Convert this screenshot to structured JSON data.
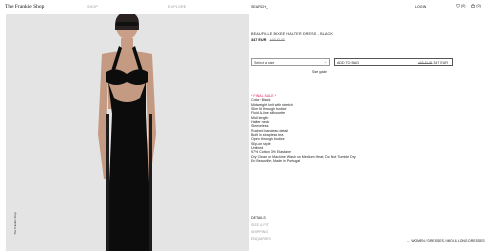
{
  "header": {
    "brand": "The Frankie Shop",
    "nav_shop": "SHOP",
    "nav_explore": "EXPLORE",
    "search": "SEARCH_",
    "login": "LOGIN",
    "wishlist_count": "(0)",
    "bag_count": "(0)"
  },
  "product": {
    "title": "BEAUFILLE BIXEE HALTER DRESS - BLACK",
    "price_now": "347 EUR",
    "price_was": "495 EUR",
    "size_placeholder": "Select a size",
    "add_to_bag": "ADD TO BAG",
    "add_to_bag_price_was": "495 EUR",
    "add_to_bag_price_now": "347 EUR",
    "size_guide": "Size guide",
    "final_sale": "* FINAL SALE *",
    "details": [
      "Color: Black",
      "Midweight knit with stretch",
      "Slim fit through bodice",
      "Fluid A-line silhouette",
      "Midi length",
      "Halter neck",
      "Sleeveless",
      "Ruched bandeau detail",
      "Built in strapless bra",
      "Open through bodice",
      "Slip-on style",
      "Unlined",
      "97% Cotton 3% Elastane",
      "Dry Clean or Machine Wash on Medium Heat; Do Not Tumble Dry",
      "En Beauville; Made in Portugal"
    ]
  },
  "sections": {
    "details": "DETAILS",
    "size_fit": "SIZE & FIT",
    "shipping": "SHIPPING",
    "enquiries": "ENQUIRIES"
  },
  "breadcrumb": "← WOMEN / DRESSES / MIDI & LONG DRESSES",
  "vertical_brand": "The Frankie Shop",
  "colors": {
    "final_sale": "#e0195c",
    "photo_bg": "#e4e4e4",
    "text": "#111111"
  }
}
